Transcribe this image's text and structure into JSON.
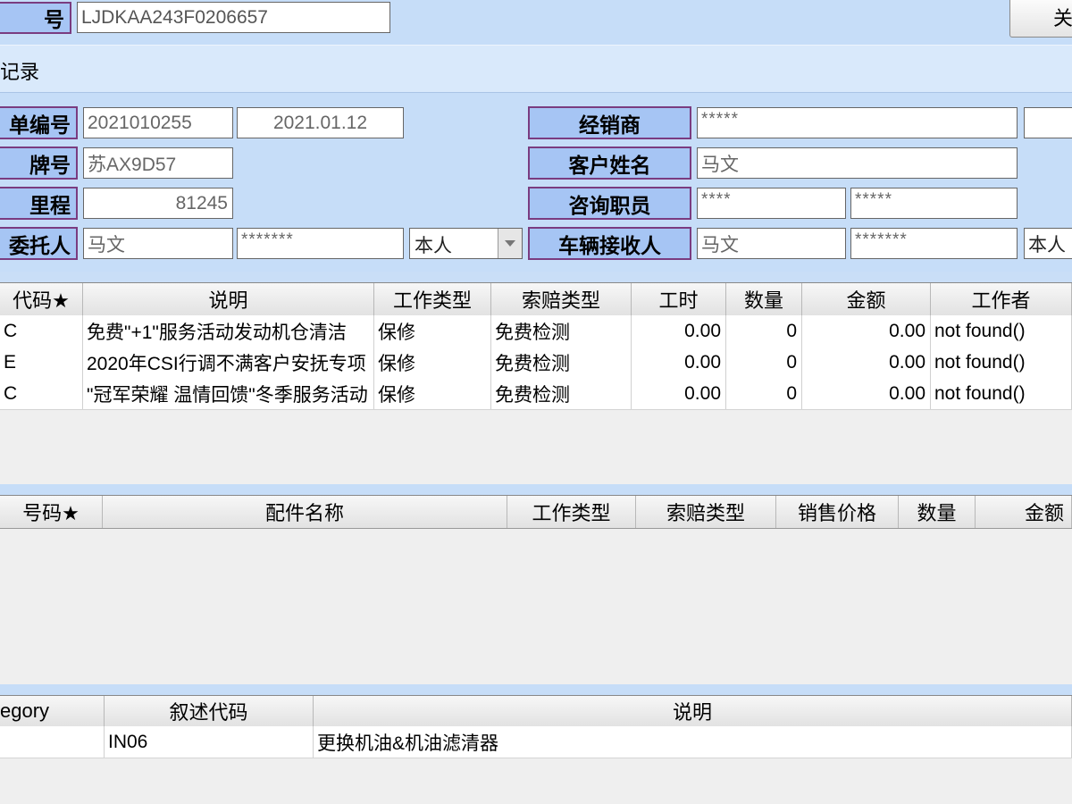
{
  "top": {
    "vin_label": "号",
    "vin_value": "LJDKAA243F0206657",
    "close_label": "关"
  },
  "record_tab": "记录",
  "form": {
    "order_no_label": "单编号",
    "order_no": "2021010255",
    "order_date": "2021.01.12",
    "plate_label": "牌号",
    "plate": "苏AX9D57",
    "mileage_label": "里程",
    "mileage": "81245",
    "client_label": "委托人",
    "client_name": "马文",
    "client_phone": "*******",
    "client_relation": "本人",
    "dealer_label": "经销商",
    "dealer": "*****",
    "customer_label": "客户姓名",
    "customer": "马文",
    "advisor_label": "咨询职员",
    "advisor_1": "****",
    "advisor_2": "*****",
    "receiver_label": "车辆接收人",
    "receiver_name": "马文",
    "receiver_phone": "*******",
    "receiver_relation": "本人"
  },
  "labor_table": {
    "headers": [
      "代码★",
      "说明",
      "工作类型",
      "索赔类型",
      "工时",
      "数量",
      "金额",
      "工作者"
    ],
    "rows": [
      [
        "C",
        "免费\"+1\"服务活动发动机仓清洁",
        "保修",
        "免费检测",
        "0.00",
        "0",
        "0.00",
        "not found()"
      ],
      [
        "E",
        "2020年CSI行调不满客户安抚专项",
        "保修",
        "免费检测",
        "0.00",
        "0",
        "0.00",
        "not found()"
      ],
      [
        "C",
        "\"冠军荣耀 温情回馈\"冬季服务活动",
        "保修",
        "免费检测",
        "0.00",
        "0",
        "0.00",
        "not found()"
      ]
    ]
  },
  "parts_table": {
    "headers": [
      "号码★",
      "配件名称",
      "工作类型",
      "索赔类型",
      "销售价格",
      "数量",
      "金额"
    ]
  },
  "desc_table": {
    "headers": [
      "egory",
      "叙述代码",
      "说明"
    ],
    "rows": [
      [
        "",
        "IN06",
        "更换机油&机油滤清器"
      ]
    ]
  }
}
